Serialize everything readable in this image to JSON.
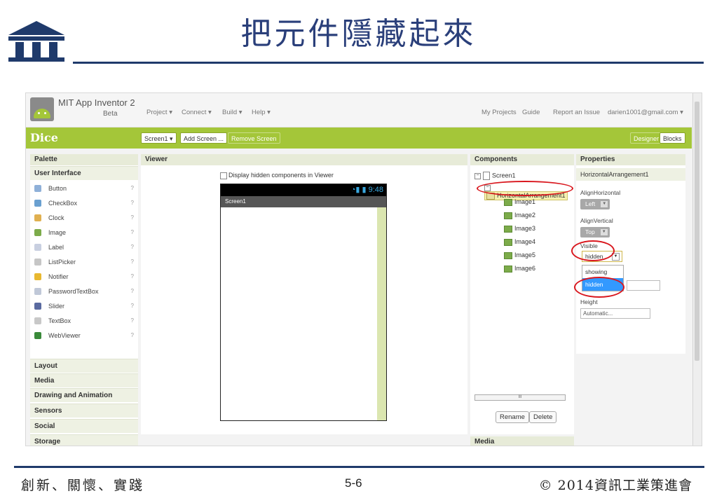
{
  "slide": {
    "title": "把元件隱藏起來",
    "footer_left": "創新、關懷、實踐",
    "footer_center": "5-6",
    "footer_right": "© 2014資訊工業策進會"
  },
  "app": {
    "name": "MIT App Inventor 2",
    "beta": "Beta",
    "menus": [
      "Project ▾",
      "Connect ▾",
      "Build ▾",
      "Help ▾"
    ],
    "right_menus": [
      "My Projects",
      "Guide",
      "Report an Issue",
      "darien1001@gmail.com ▾"
    ]
  },
  "project_bar": {
    "project_name": "Dice",
    "screen_select": "Screen1 ▾",
    "add_screen": "Add Screen ...",
    "remove_screen": "Remove Screen",
    "designer": "Designer",
    "blocks": "Blocks"
  },
  "palette": {
    "heading": "Palette",
    "section": "User Interface",
    "help_glyph": "?",
    "items": [
      {
        "label": "Button",
        "icon": "button-icon",
        "color": "#8fb0d8"
      },
      {
        "label": "CheckBox",
        "icon": "checkbox-icon",
        "color": "#6aa0d0"
      },
      {
        "label": "Clock",
        "icon": "clock-icon",
        "color": "#e0b050"
      },
      {
        "label": "Image",
        "icon": "image-icon",
        "color": "#7cab4a"
      },
      {
        "label": "Label",
        "icon": "label-icon",
        "color": "#c8cfe0"
      },
      {
        "label": "ListPicker",
        "icon": "listpicker-icon",
        "color": "#c6c6c6"
      },
      {
        "label": "Notifier",
        "icon": "notifier-icon",
        "color": "#e8b830"
      },
      {
        "label": "PasswordTextBox",
        "icon": "password-icon",
        "color": "#c0c8d8"
      },
      {
        "label": "Slider",
        "icon": "slider-icon",
        "color": "#5a6aa0"
      },
      {
        "label": "TextBox",
        "icon": "textbox-icon",
        "color": "#c8c8c8"
      },
      {
        "label": "WebViewer",
        "icon": "globe-icon",
        "color": "#3a8a3a"
      }
    ],
    "categories": [
      "Layout",
      "Media",
      "Drawing and Animation",
      "Sensors",
      "Social",
      "Storage"
    ]
  },
  "viewer": {
    "heading": "Viewer",
    "display_hidden": "Display hidden components in Viewer",
    "status_time": "9:48",
    "screen_title": "Screen1"
  },
  "components": {
    "heading": "Components",
    "screen": "Screen1",
    "arrangement": "HorizontalArrangement1",
    "images": [
      "Image1",
      "Image2",
      "Image3",
      "Image4",
      "Image5",
      "Image6"
    ],
    "scroll_label": "III",
    "rename": "Rename",
    "delete": "Delete",
    "media_heading": "Media"
  },
  "properties": {
    "heading": "Properties",
    "component": "HorizontalArrangement1",
    "align_horizontal_label": "AlignHorizontal",
    "align_horizontal_value": "Left",
    "align_vertical_label": "AlignVertical",
    "align_vertical_value": "Top",
    "visible_label": "Visible",
    "visible_value": "hidden",
    "visible_options": [
      "showing",
      "hidden"
    ],
    "height_label": "Height",
    "height_value": "Automatic..."
  },
  "colors": {
    "accent_green": "#a4c639",
    "highlight_red": "#d9171e",
    "selection_blue": "#3399ff",
    "slide_navy": "#1f3a6b"
  }
}
